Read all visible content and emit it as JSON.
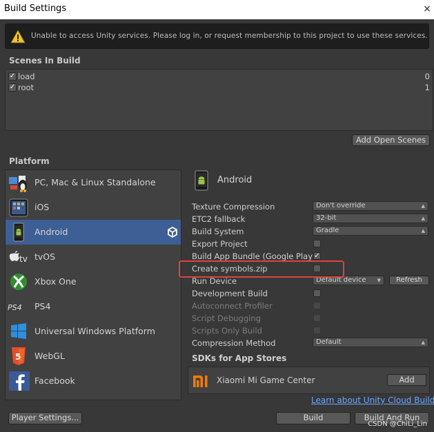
{
  "window": {
    "title": "Build Settings",
    "close_glyph": "×"
  },
  "warning": {
    "icon": "warning-icon",
    "text": "Unable to access Unity services. Please log in, or request membership to this project to use these services."
  },
  "scenes": {
    "title": "Scenes In Build",
    "items": [
      {
        "name": "load",
        "index": "0",
        "checked": true
      },
      {
        "name": "root",
        "index": "1",
        "checked": true
      }
    ],
    "add_open_scenes": "Add Open Scenes"
  },
  "platform": {
    "title": "Platform",
    "items": [
      {
        "label": "PC, Mac & Linux Standalone",
        "icon": "pc-mac-linux-icon"
      },
      {
        "label": "iOS",
        "icon": "ios-device-icon"
      },
      {
        "label": "Android",
        "icon": "android-icon",
        "selected": true
      },
      {
        "label": "tvOS",
        "icon": "apple-tv-icon"
      },
      {
        "label": "Xbox One",
        "icon": "xbox-icon"
      },
      {
        "label": "PS4",
        "icon": "ps4-icon"
      },
      {
        "label": "Universal Windows Platform",
        "icon": "windows-icon"
      },
      {
        "label": "WebGL",
        "icon": "html5-icon"
      },
      {
        "label": "Facebook",
        "icon": "facebook-icon"
      }
    ],
    "selected_label": "Android"
  },
  "android_settings": {
    "header": "Android",
    "texture_compression": {
      "label": "Texture Compression",
      "value": "Don't override"
    },
    "etc2_fallback": {
      "label": "ETC2 fallback",
      "value": "32-bit"
    },
    "build_system": {
      "label": "Build System",
      "value": "Gradle"
    },
    "export_project": {
      "label": "Export Project",
      "checked": false
    },
    "build_app_bundle": {
      "label": "Build App Bundle (Google Play",
      "checked": true
    },
    "create_symbols": {
      "label": "Create symbols.zip",
      "checked": false
    },
    "run_device": {
      "label": "Run Device",
      "value": "Default device",
      "refresh": "Refresh"
    },
    "development_build": {
      "label": "Development Build",
      "checked": false
    },
    "autoconnect_profiler": {
      "label": "Autoconnect Profiler",
      "checked": false
    },
    "script_debugging": {
      "label": "Script Debugging",
      "checked": false
    },
    "scripts_only_build": {
      "label": "Scripts Only Build",
      "checked": false
    },
    "compression_method": {
      "label": "Compression Method",
      "value": "Default"
    }
  },
  "sdks": {
    "title": "SDKs for App Stores",
    "items": [
      {
        "name": "Xiaomi Mi Game Center",
        "button": "Add",
        "icon": "xiaomi-icon"
      }
    ]
  },
  "footer": {
    "cloud_link": "Learn about Unity Cloud Build",
    "player_settings": "Player Settings...",
    "build": "Build",
    "build_and_run": "Build And Run",
    "watermark": "CSDN @ChiLi_Lin"
  },
  "colors": {
    "panel": "#383838",
    "selected": "#3e5f96",
    "highlight": "#e0433b",
    "link": "#6aa6ff"
  }
}
